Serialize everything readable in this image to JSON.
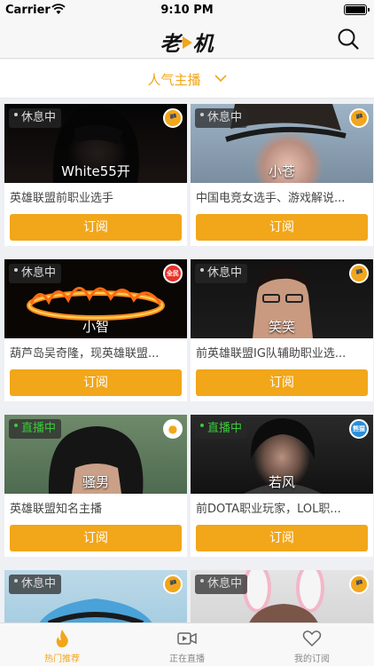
{
  "status_bar": {
    "carrier": "Carrier",
    "time": "9:10 PM"
  },
  "app": {
    "logo_left": "老",
    "logo_right": "机"
  },
  "filter": {
    "label": "人气主播"
  },
  "colors": {
    "accent": "#f2a619",
    "live": "#3cc83c"
  },
  "cards": [
    {
      "status": "休息中",
      "live": false,
      "platform": "zhanqi",
      "name": "White55开",
      "desc": "英雄联盟前职业选手",
      "button": "订阅"
    },
    {
      "status": "休息中",
      "live": false,
      "platform": "zhanqi",
      "name": "小苍",
      "desc": "中国电竞女选手、游戏解说...",
      "button": "订阅"
    },
    {
      "status": "休息中",
      "live": false,
      "platform": "quanmin",
      "name": "小智",
      "desc": "葫芦岛吴奇隆，现英雄联盟...",
      "button": "订阅"
    },
    {
      "status": "休息中",
      "live": false,
      "platform": "zhanqi",
      "name": "笑笑",
      "desc": "前英雄联盟IG队辅助职业选...",
      "button": "订阅"
    },
    {
      "status": "直播中",
      "live": true,
      "platform": "huya",
      "name": "骚男",
      "desc": "英雄联盟知名主播",
      "button": "订阅"
    },
    {
      "status": "直播中",
      "live": true,
      "platform": "panda",
      "name": "若风",
      "desc": "前DOTA职业玩家，LOL职...",
      "button": "订阅"
    },
    {
      "status": "休息中",
      "live": false,
      "platform": "zhanqi",
      "name": "",
      "desc": "",
      "button": ""
    },
    {
      "status": "休息中",
      "live": false,
      "platform": "zhanqi",
      "name": "",
      "desc": "",
      "button": ""
    }
  ],
  "tabs": [
    {
      "label": "热门推荐",
      "icon": "flame-icon",
      "active": true
    },
    {
      "label": "正在直播",
      "icon": "video-camera-icon",
      "active": false
    },
    {
      "label": "我的订阅",
      "icon": "heart-icon",
      "active": false
    }
  ]
}
